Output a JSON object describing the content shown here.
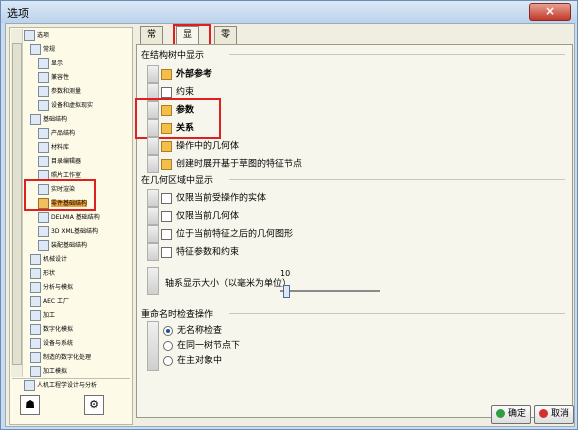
{
  "window": {
    "title": "选项"
  },
  "tree": {
    "items": [
      {
        "label": "选项"
      },
      {
        "label": "常规"
      },
      {
        "label": "显示"
      },
      {
        "label": "兼容性"
      },
      {
        "label": "参数和测量"
      },
      {
        "label": "设备和虚拟现实"
      },
      {
        "label": "基础结构"
      },
      {
        "label": "产品结构"
      },
      {
        "label": "材料库"
      },
      {
        "label": "目录编辑器"
      },
      {
        "label": "照片工作室"
      },
      {
        "label": "实时渲染"
      },
      {
        "label": "零件基础结构"
      },
      {
        "label": "DELMIA 基础结构"
      },
      {
        "label": "3D XML基础结构"
      },
      {
        "label": "装配基础结构"
      },
      {
        "label": "机械设计"
      },
      {
        "label": "形状"
      },
      {
        "label": "分析与模拟"
      },
      {
        "label": "AEC 工厂"
      },
      {
        "label": "加工"
      },
      {
        "label": "数字化模拟"
      },
      {
        "label": "设备与系统"
      },
      {
        "label": "制造的数字化处理"
      },
      {
        "label": "加工模拟"
      },
      {
        "label": "人机工程学设计与分析"
      }
    ]
  },
  "tabs": [
    {
      "label": "常规"
    },
    {
      "label": "显示"
    },
    {
      "label": "零件文档"
    }
  ],
  "groups": {
    "tree_display": {
      "title": "在结构树中显示",
      "options": [
        {
          "label": "外部参考",
          "checked": true
        },
        {
          "label": "约束",
          "checked": false
        },
        {
          "label": "参数",
          "checked": true
        },
        {
          "label": "关系",
          "checked": true
        },
        {
          "label": "操作中的几何体",
          "checked": true
        },
        {
          "label": "创建时展开基于草图的特征节点",
          "checked": true
        }
      ]
    },
    "geometry_display": {
      "title": "在几何区域中显示",
      "options": [
        {
          "label": "仅限当前受操作的实体",
          "checked": false
        },
        {
          "label": "仅限当前几何体",
          "checked": false
        },
        {
          "label": "位于当前特征之后的几何图形",
          "checked": false
        },
        {
          "label": "特征参数和约束",
          "checked": false
        }
      ],
      "axis_label": "轴系显示大小（以毫米为单位）",
      "axis_value": "10"
    },
    "rename": {
      "title": "重命名时检查操作",
      "options": [
        {
          "label": "无名称检查",
          "selected": true
        },
        {
          "label": "在同一树节点下",
          "selected": false
        },
        {
          "label": "在主对象中",
          "selected": false
        }
      ]
    }
  },
  "buttons": {
    "ok": "确定",
    "cancel": "取消",
    "close": "×"
  },
  "colors": {
    "accent": "#e02020",
    "checked": "#f2c04a",
    "ok": "#2e9e3e",
    "cancel": "#d23030"
  }
}
